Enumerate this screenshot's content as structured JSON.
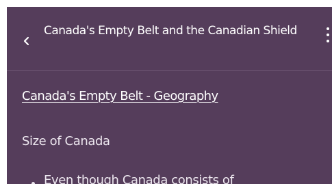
{
  "header": {
    "title": "Canada's Empty Belt and the Canadian Shield",
    "back_icon": "chevron-left-icon",
    "menu_icon": "more-vertical-icon"
  },
  "content": {
    "section_link": "Canada's Empty Belt - Geography",
    "subheading": "Size of Canada",
    "bullets": [
      "Even though Canada consists of"
    ]
  },
  "colors": {
    "background": "#553d5b",
    "text": "#ffffff",
    "divider": "#6f5876"
  }
}
